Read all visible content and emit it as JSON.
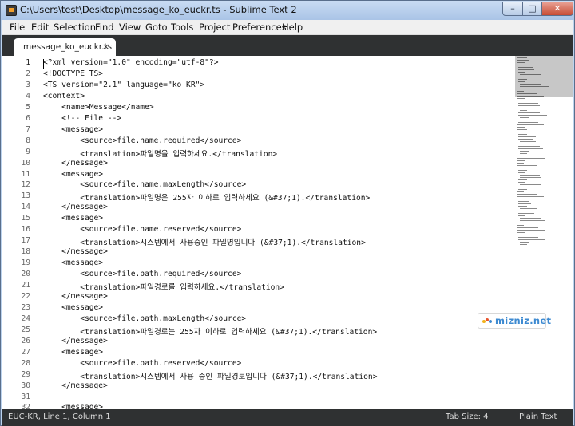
{
  "window": {
    "title": "C:\\Users\\test\\Desktop\\message_ko_euckr.ts - Sublime Text 2",
    "minimize_label": "–",
    "maximize_label": "□",
    "close_label": "✕"
  },
  "menu": {
    "items": [
      "File",
      "Edit",
      "Selection",
      "Find",
      "View",
      "Goto",
      "Tools",
      "Project",
      "Preferences",
      "Help"
    ]
  },
  "tabs": [
    {
      "label": "message_ko_euckr.ts",
      "close": "×"
    }
  ],
  "editor": {
    "lines": [
      {
        "num": "1",
        "text": "<?xml version=\"1.0\" encoding=\"utf-8\"?>"
      },
      {
        "num": "2",
        "text": "<!DOCTYPE TS>"
      },
      {
        "num": "3",
        "text": "<TS version=\"2.1\" language=\"ko_KR\">"
      },
      {
        "num": "4",
        "text": "<context>"
      },
      {
        "num": "5",
        "text": "    <name>Message</name>"
      },
      {
        "num": "6",
        "text": "    <!-- File -->"
      },
      {
        "num": "7",
        "text": "    <message>"
      },
      {
        "num": "8",
        "text": "        <source>file.name.required</source>"
      },
      {
        "num": "9",
        "text": "        <translation>파일명을 입력하세요.</translation>"
      },
      {
        "num": "10",
        "text": "    </message>"
      },
      {
        "num": "11",
        "text": "    <message>"
      },
      {
        "num": "12",
        "text": "        <source>file.name.maxLength</source>"
      },
      {
        "num": "13",
        "text": "        <translation>파일명은 255자 이하로 입력하세요 (&#37;1).</translation>"
      },
      {
        "num": "14",
        "text": "    </message>"
      },
      {
        "num": "15",
        "text": "    <message>"
      },
      {
        "num": "16",
        "text": "        <source>file.name.reserved</source>"
      },
      {
        "num": "17",
        "text": "        <translation>시스템에서 사용중인 파일명입니다 (&#37;1).</translation>"
      },
      {
        "num": "18",
        "text": "    </message>"
      },
      {
        "num": "19",
        "text": "    <message>"
      },
      {
        "num": "20",
        "text": "        <source>file.path.required</source>"
      },
      {
        "num": "21",
        "text": "        <translation>파일경로를 입력하세요.</translation>"
      },
      {
        "num": "22",
        "text": "    </message>"
      },
      {
        "num": "23",
        "text": "    <message>"
      },
      {
        "num": "24",
        "text": "        <source>file.path.maxLength</source>"
      },
      {
        "num": "25",
        "text": "        <translation>파일경로는 255자 이하로 입력하세요 (&#37;1).</translation>"
      },
      {
        "num": "26",
        "text": "    </message>"
      },
      {
        "num": "27",
        "text": "    <message>"
      },
      {
        "num": "28",
        "text": "        <source>file.path.reserved</source>"
      },
      {
        "num": "29",
        "text": "        <translation>시스템에서 사용 중인 파일경로입니다 (&#37;1).</translation>"
      },
      {
        "num": "30",
        "text": "    </message>"
      },
      {
        "num": "31",
        "text": ""
      },
      {
        "num": "32",
        "text": "    <message>"
      }
    ]
  },
  "watermark": {
    "text": "mizniz.net"
  },
  "status": {
    "encoding_position": "EUC-KR, Line 1, Column 1",
    "tab_size": "Tab Size: 4",
    "syntax": "Plain Text"
  },
  "colors": {
    "title_bar": "#b5cde9",
    "tab_bar": "#2f3132",
    "status_bar": "#2f3132",
    "editor_bg": "#ffffff",
    "watermark_text": "#3d8ad1"
  }
}
